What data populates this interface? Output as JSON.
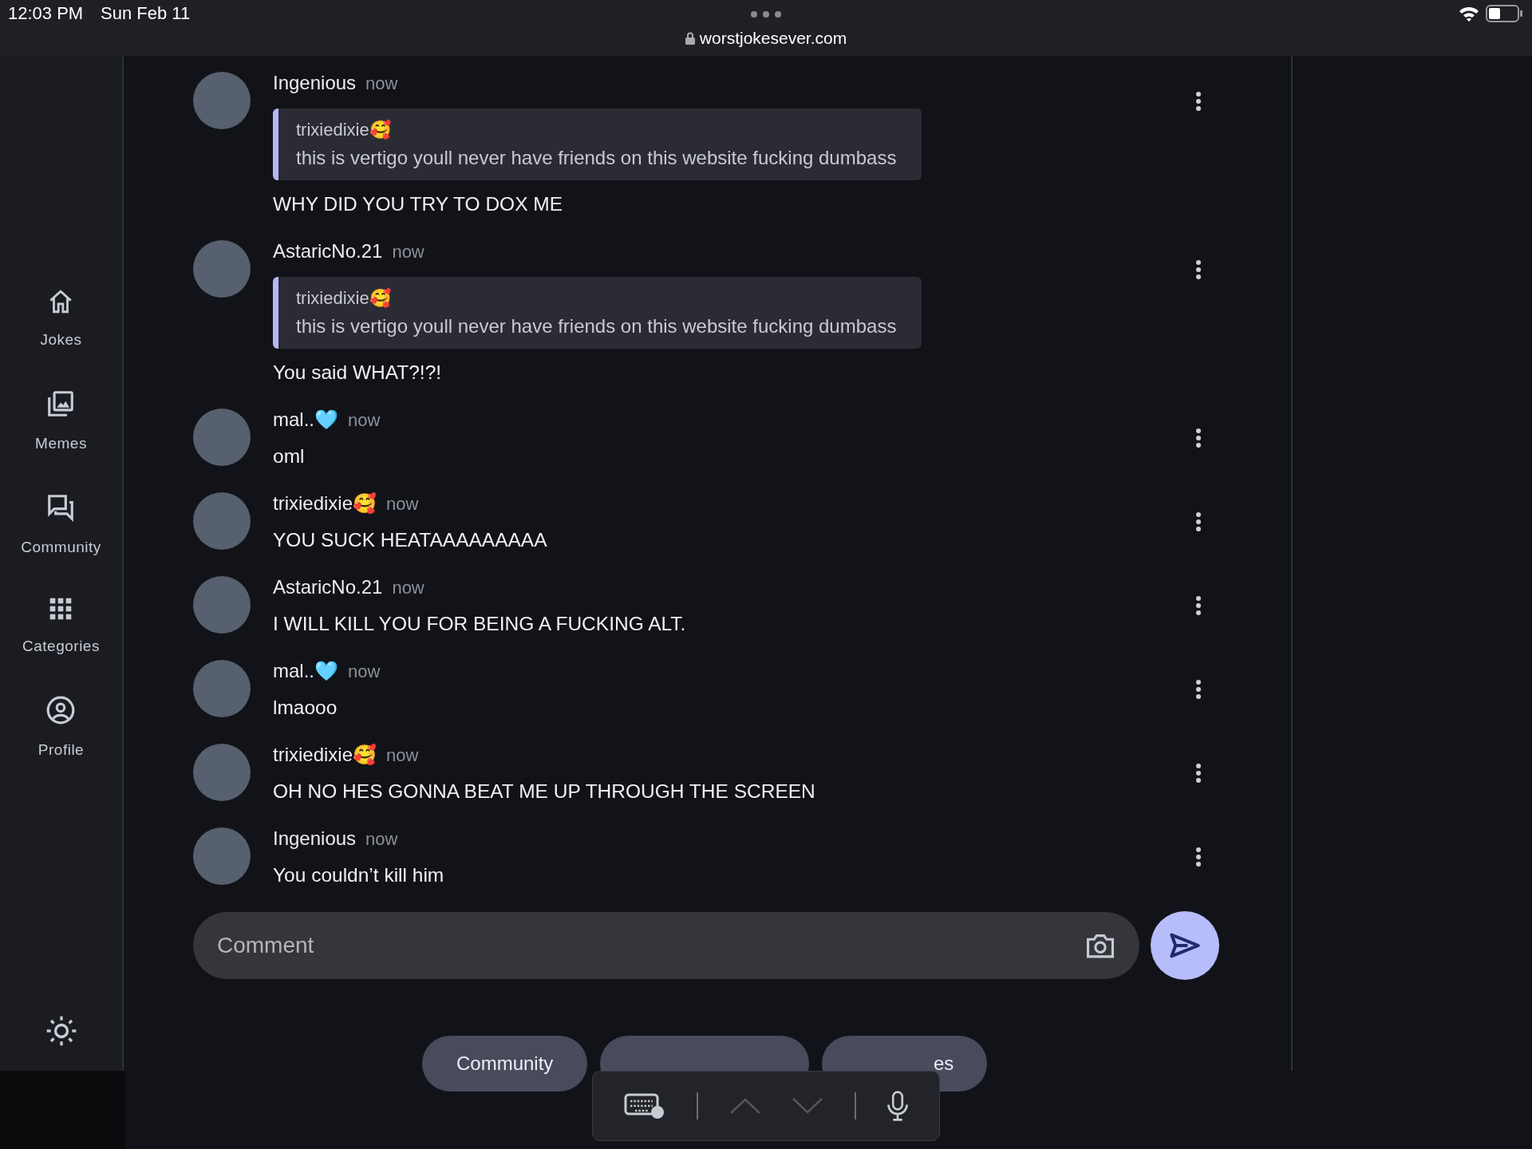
{
  "status_bar": {
    "time": "12:03 PM",
    "date": "Sun Feb 11",
    "url": "worstjokesever.com"
  },
  "sidebar": {
    "items": [
      {
        "label": "Jokes",
        "kind": "home"
      },
      {
        "label": "Memes",
        "kind": "images"
      },
      {
        "label": "Community",
        "kind": "chat"
      },
      {
        "label": "Categories",
        "kind": "grid"
      },
      {
        "label": "Profile",
        "kind": "profile"
      }
    ]
  },
  "messages": [
    {
      "user": "Ingenious",
      "time": "now",
      "quote": {
        "user": "trixiedixie🥰",
        "text": "this is vertigo youll never have friends on this website fucking dumbass"
      },
      "text": "WHY DID YOU TRY TO DOX ME"
    },
    {
      "user": "AstaricNo.21",
      "time": "now",
      "quote": {
        "user": "trixiedixie🥰",
        "text": "this is vertigo youll never have friends on this website fucking dumbass"
      },
      "text": "You said WHAT?!?!"
    },
    {
      "user": "mal..🩵",
      "time": "now",
      "text": "oml"
    },
    {
      "user": "trixiedixie🥰",
      "time": "now",
      "text": "YOU SUCK HEATAAAAAAAAA"
    },
    {
      "user": "AstaricNo.21",
      "time": "now",
      "text": "I WILL KILL YOU FOR BEING A FUCKING ALT."
    },
    {
      "user": "mal..🩵",
      "time": "now",
      "text": "lmaooo"
    },
    {
      "user": "trixiedixie🥰",
      "time": "now",
      "text": "OH NO HES GONNA BEAT ME UP THROUGH THE SCREEN"
    },
    {
      "user": "Ingenious",
      "time": "now",
      "text": "You couldn’t kill him"
    }
  ],
  "comment": {
    "placeholder": "Comment"
  },
  "chips": [
    {
      "kind": "chip",
      "label": "Community"
    },
    {
      "kind": "chip"
    },
    {
      "kind": "chip",
      "label": "es"
    }
  ]
}
